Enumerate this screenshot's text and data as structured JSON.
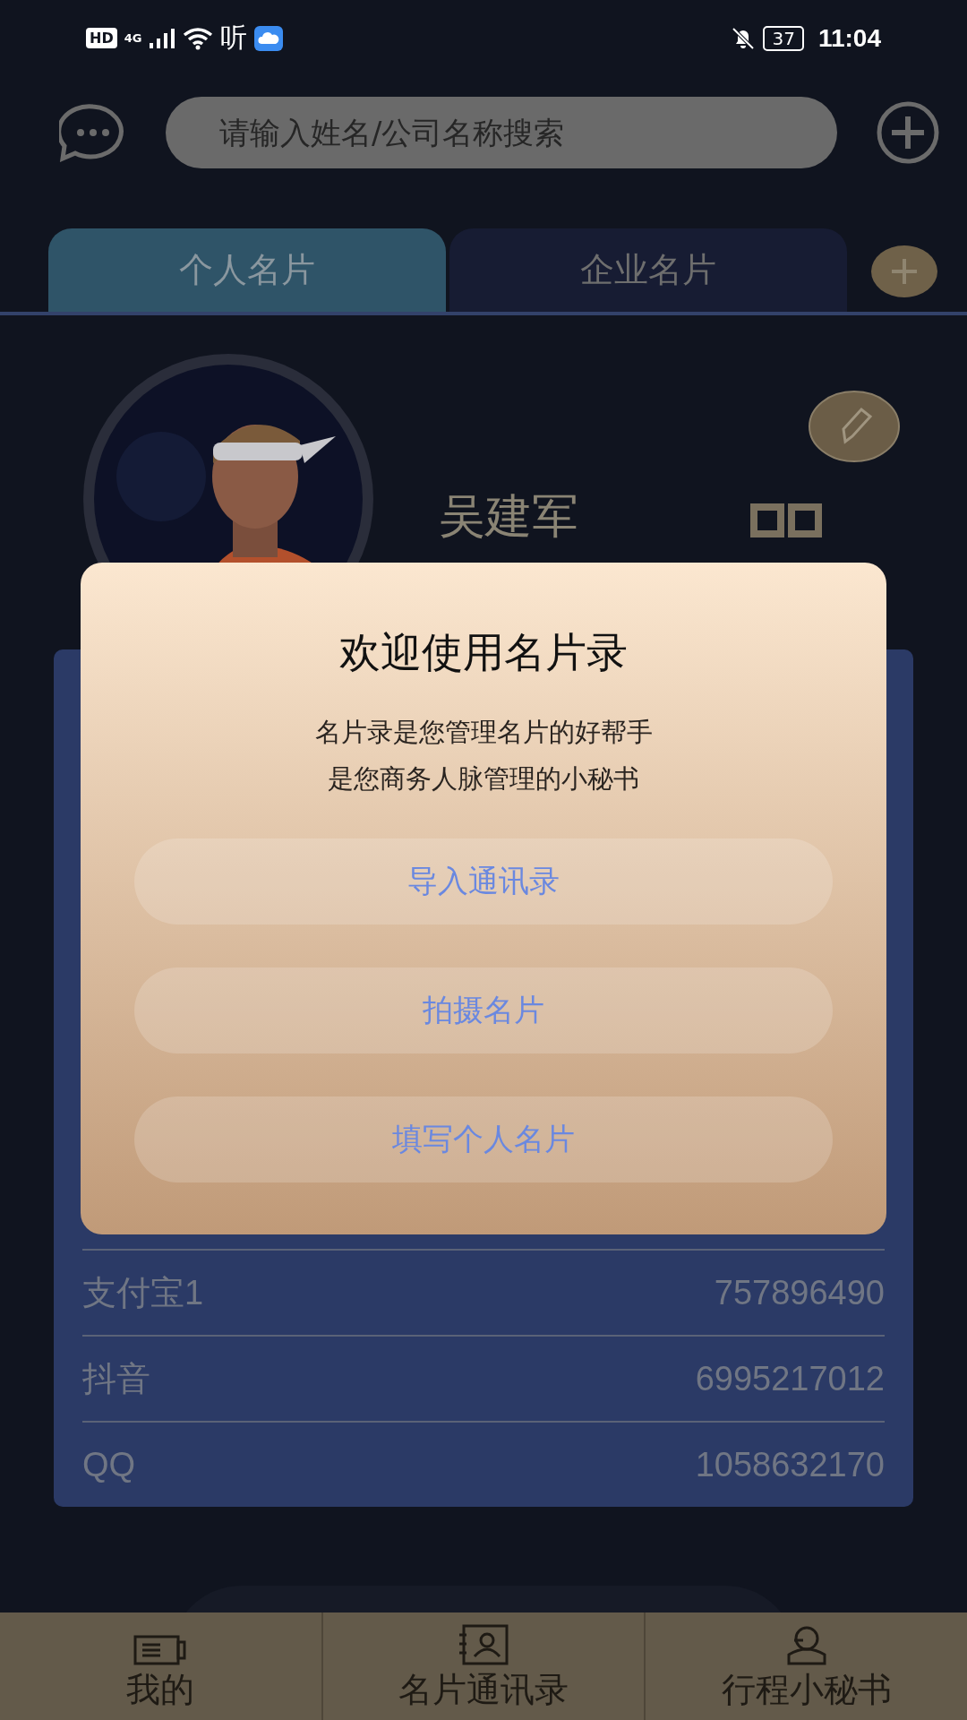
{
  "status_bar": {
    "hd": "HD",
    "network": "4G",
    "listen": "听",
    "battery": "37",
    "time": "11:04"
  },
  "search": {
    "placeholder": "请输入姓名/公司名称搜索"
  },
  "tabs": [
    {
      "label": "个人名片",
      "selected": true
    },
    {
      "label": "企业名片",
      "selected": false
    }
  ],
  "profile": {
    "name": "吴建军"
  },
  "card_rows": [
    {
      "label": "支付宝1",
      "value": "757896490"
    },
    {
      "label": "抖音",
      "value": "6995217012"
    },
    {
      "label": "QQ",
      "value": "1058632170"
    }
  ],
  "dialog": {
    "title": "欢迎使用名片录",
    "lines": [
      "名片录是您管理名片的好帮手",
      "是您商务人脉管理的小秘书"
    ],
    "buttons": [
      "导入通讯录",
      "拍摄名片",
      "填写个人名片"
    ]
  },
  "bottom_nav": [
    {
      "label": "我的"
    },
    {
      "label": "名片通讯录"
    },
    {
      "label": "行程小秘书"
    }
  ]
}
